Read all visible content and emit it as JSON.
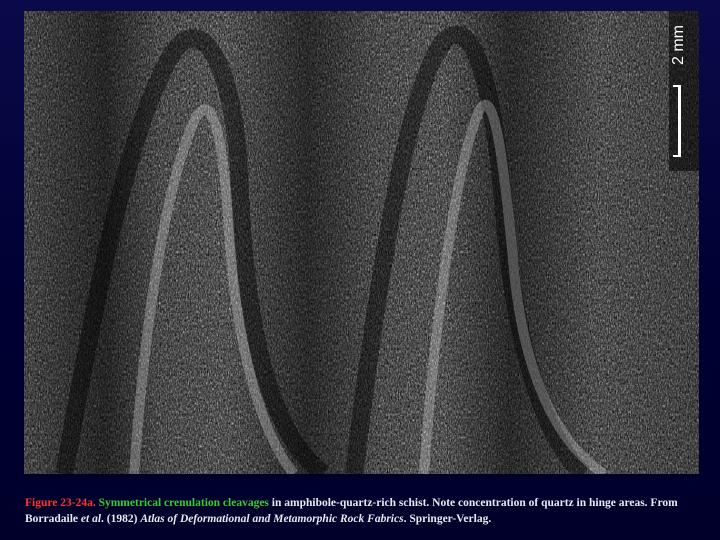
{
  "slide": {
    "scale_label": "2 mm",
    "caption": {
      "figure_label": "Figure 23-24a.",
      "highlight": "Symmetrical crenulation cleavages",
      "body_1": " in amphibole-quartz-rich schist. Note concentration of quartz in hinge areas. From Borradaile ",
      "etal": "et al",
      "body_2": ". (1982) ",
      "book_title": "Atlas of Deformational and Metamorphic Rock Fabrics",
      "body_3": ". Springer-Verlag."
    },
    "colors": {
      "background": "#000033",
      "figure_label": "#ff3333",
      "highlight": "#33cc33",
      "text": "#e8e8f0"
    }
  }
}
